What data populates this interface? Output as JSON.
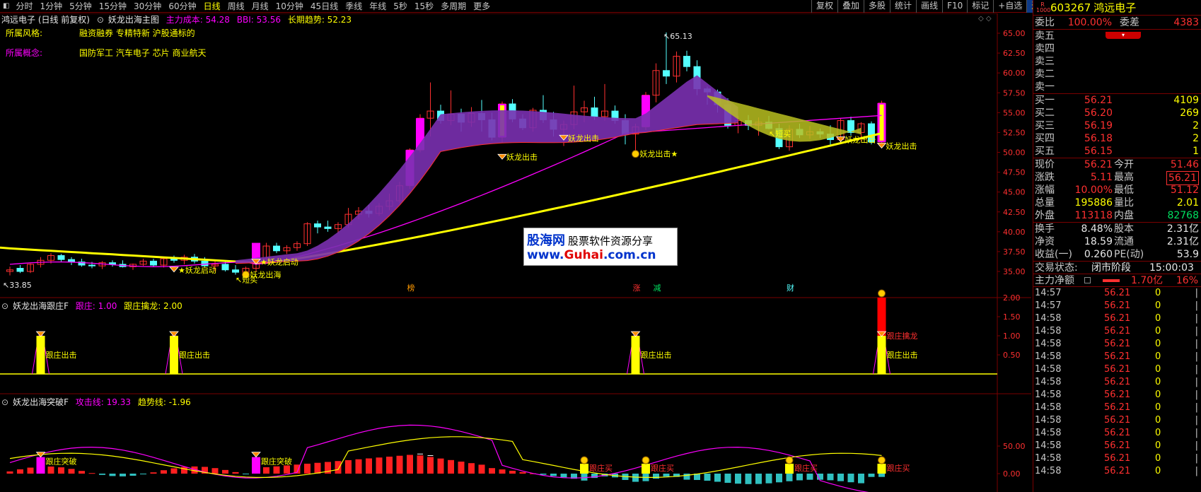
{
  "toolbar": {
    "periods": [
      "分时",
      "1分钟",
      "5分钟",
      "15分钟",
      "30分钟",
      "60分钟",
      "日线",
      "周线",
      "月线",
      "10分钟",
      "45日线",
      "季线",
      "年线",
      "5秒",
      "15秒",
      "多周期",
      "更多"
    ],
    "active": "日线",
    "right_buttons": [
      "复权",
      "叠加",
      "多股",
      "统计",
      "画线",
      "F10",
      "标记",
      "+自选",
      "返回"
    ]
  },
  "main": {
    "stock_title": "鸿远电子 (日线 前复权)",
    "indicator_name": "妖龙出海主图",
    "cost_label": "主力成本: 54.28",
    "bbi_label": "BBI: 53.56",
    "trend_label": "长期趋势: 52.23",
    "style_label": "所属风格:",
    "style_value": "融资融券 专精特新 沪股通标的",
    "concept_label": "所属概念:",
    "concept_value": "国防军工 汽车电子 芯片 商业航天",
    "high_mark": "65.13",
    "low_mark": "33.85",
    "y_ticks": [
      "65.00",
      "62.50",
      "60.00",
      "57.50",
      "55.00",
      "52.50",
      "50.00",
      "47.50",
      "45.00",
      "42.50",
      "40.00",
      "37.50",
      "35.00"
    ],
    "annotations": {
      "start1": "★妖龙启动",
      "start2": "妖龙出海",
      "start3": "★妖龙启动",
      "short_buy": "短买",
      "exit": "妖龙出击",
      "star_label": "妖龙出击★",
      "bang": "榜",
      "zhang": "涨",
      "jian": "减",
      "cai": "财"
    }
  },
  "panel2": {
    "name": "妖龙出海跟庄F",
    "l1": "跟庄: 1.00",
    "l2": "跟庄擒龙: 2.00",
    "y_ticks": [
      "2.00",
      "1.50",
      "1.00",
      "0.50"
    ],
    "exit_label": "跟庄出击",
    "catch_label": "跟庄擒龙"
  },
  "panel3": {
    "name": "妖龙出海突破F",
    "l1": "攻击线: 19.33",
    "l2": "趋势线: -1.96",
    "y_ticks": [
      "50.00",
      "0.00"
    ],
    "break_label": "跟庄突破",
    "buy_label": "跟庄买"
  },
  "watermark": {
    "brand": "股海网",
    "slogan": "股票软件资源分享",
    "url_a": "www.",
    "url_b": "Guhai",
    "url_c": ".com.cn"
  },
  "quote": {
    "code": "603267",
    "name": "鸿远电子",
    "badge": "R 1000",
    "ratio_label": "委比",
    "ratio_value": "100.00%",
    "diff_label": "委差",
    "diff_value": "4383",
    "sells": [
      {
        "label": "卖五",
        "price": "",
        "vol": ""
      },
      {
        "label": "卖四",
        "price": "",
        "vol": ""
      },
      {
        "label": "卖三",
        "price": "",
        "vol": ""
      },
      {
        "label": "卖二",
        "price": "",
        "vol": ""
      },
      {
        "label": "卖一",
        "price": "",
        "vol": ""
      }
    ],
    "buys": [
      {
        "label": "买一",
        "price": "56.21",
        "vol": "4109"
      },
      {
        "label": "买二",
        "price": "56.20",
        "vol": "269"
      },
      {
        "label": "买三",
        "price": "56.19",
        "vol": "2"
      },
      {
        "label": "买四",
        "price": "56.18",
        "vol": "2"
      },
      {
        "label": "买五",
        "price": "56.15",
        "vol": "1"
      }
    ],
    "stats": [
      {
        "l1": "现价",
        "v1": "56.21",
        "l2": "今开",
        "v2": "51.46",
        "c1": "red",
        "c2": "red"
      },
      {
        "l1": "涨跌",
        "v1": "5.11",
        "l2": "最高",
        "v2": "56.21",
        "c1": "red",
        "c2": "red"
      },
      {
        "l1": "涨幅",
        "v1": "10.00%",
        "l2": "最低",
        "v2": "51.12",
        "c1": "red",
        "c2": "red"
      },
      {
        "l1": "总量",
        "v1": "195886",
        "l2": "量比",
        "v2": "2.01",
        "c1": "yellow",
        "c2": "yellow"
      },
      {
        "l1": "外盘",
        "v1": "113118",
        "l2": "内盘",
        "v2": "82768",
        "c1": "red",
        "c2": "green"
      }
    ],
    "stats2": [
      {
        "l1": "换手",
        "v1": "8.48%",
        "l2": "股本",
        "v2": "2.31亿"
      },
      {
        "l1": "净资",
        "v1": "18.59",
        "l2": "流通",
        "v2": "2.31亿"
      },
      {
        "l1": "收益(一)",
        "v1": "0.260",
        "l2": "PE(动)",
        "v2": "53.9"
      }
    ],
    "trade_status_label": "交易状态:",
    "trade_status": "闭市阶段",
    "trade_time": "15:00:03",
    "main_net_label": "主力净额",
    "main_net_value": "1.70亿",
    "main_net_pct": "16%",
    "ticks": [
      {
        "t": "14:57",
        "p": "56.21",
        "v": "0"
      },
      {
        "t": "14:57",
        "p": "56.21",
        "v": "0"
      },
      {
        "t": "14:58",
        "p": "56.21",
        "v": "0"
      },
      {
        "t": "14:58",
        "p": "56.21",
        "v": "0"
      },
      {
        "t": "14:58",
        "p": "56.21",
        "v": "0"
      },
      {
        "t": "14:58",
        "p": "56.21",
        "v": "0"
      },
      {
        "t": "14:58",
        "p": "56.21",
        "v": "0"
      },
      {
        "t": "14:58",
        "p": "56.21",
        "v": "0"
      },
      {
        "t": "14:58",
        "p": "56.21",
        "v": "0"
      },
      {
        "t": "14:58",
        "p": "56.21",
        "v": "0"
      },
      {
        "t": "14:58",
        "p": "56.21",
        "v": "0"
      },
      {
        "t": "14:58",
        "p": "56.21",
        "v": "0"
      },
      {
        "t": "14:58",
        "p": "56.21",
        "v": "0"
      },
      {
        "t": "14:58",
        "p": "56.21",
        "v": "0"
      },
      {
        "t": "14:58",
        "p": "56.21",
        "v": "0"
      }
    ],
    "ticks_flags": [
      "|",
      "|",
      "|",
      "|",
      "|",
      "|",
      "|",
      "|",
      "|",
      "|",
      "|",
      "|",
      "|",
      "|",
      "|"
    ]
  },
  "colors": {
    "up": "#ff3030",
    "down": "#54ffff",
    "magenta": "#ff00ff",
    "yellow": "#ffff00",
    "purple": "#7a30b0"
  }
}
